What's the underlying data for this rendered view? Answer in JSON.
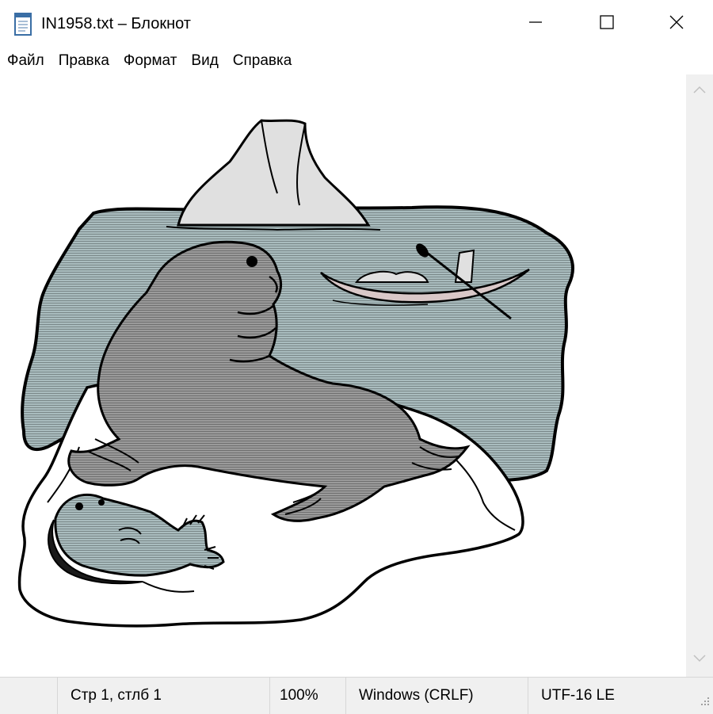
{
  "window": {
    "title": "IN1958.txt – Блокнот",
    "icons": {
      "app": "notepad-icon",
      "minimize": "minimize-icon",
      "maximize": "maximize-icon",
      "close": "close-icon"
    }
  },
  "menu": {
    "items": [
      {
        "label": "Файл"
      },
      {
        "label": "Правка"
      },
      {
        "label": "Формат"
      },
      {
        "label": "Вид"
      },
      {
        "label": "Справка"
      }
    ]
  },
  "editor": {
    "content_icon": "ascii-art-seals-on-ice-floe",
    "colors": {
      "water": "#a9bcbe",
      "seal": "#9a9a9a",
      "ice": "#e0e0e0",
      "outline": "#000000",
      "boat": "#d9c8c8"
    }
  },
  "scrollbar": {
    "up_icon": "chevron-up-icon",
    "down_icon": "chevron-down-icon"
  },
  "status": {
    "position": "Стр 1, стлб 1",
    "zoom": "100%",
    "line_endings": "Windows (CRLF)",
    "encoding": "UTF-16 LE",
    "grip_icon": "resize-grip-icon"
  }
}
